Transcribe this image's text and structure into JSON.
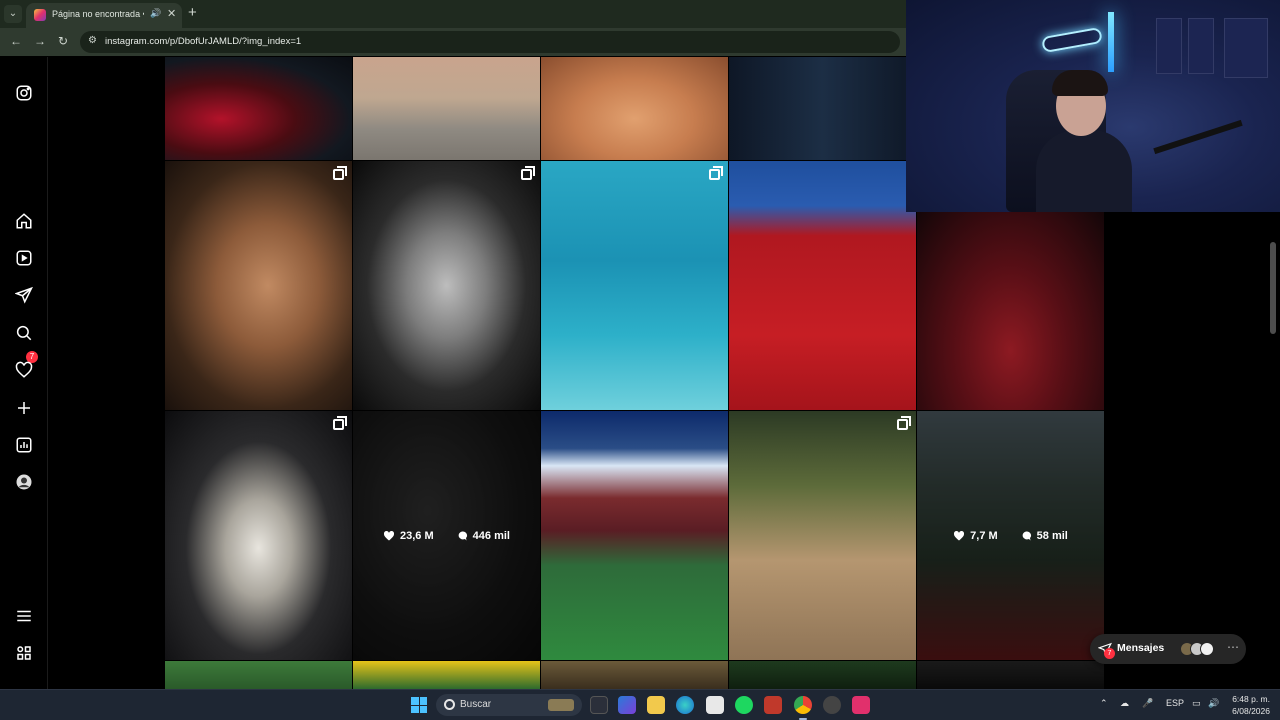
{
  "browser": {
    "tab_title": "Página no encontrada • Insta",
    "new_tab_label": "+",
    "url": "instagram.com/p/DbofUrJAMLD/?img_index=1"
  },
  "rail": {
    "notifications_badge": "7"
  },
  "grid": {
    "tiles": [
      {
        "likes": "23,6 M",
        "comments": "446 mil"
      },
      {
        "likes": "7,7 M",
        "comments": "58 mil"
      }
    ]
  },
  "messages": {
    "label": "Mensajes",
    "badge": "7"
  },
  "taskbar": {
    "search_placeholder": "Buscar",
    "language": "ESP",
    "time": "6:48 p. m.",
    "date": "6/08/2026"
  },
  "colors": {
    "browser_bar": "#2f3a2f",
    "instagram_bg": "#000000",
    "badge": "#ff3040",
    "taskbar": "#1e2633"
  }
}
